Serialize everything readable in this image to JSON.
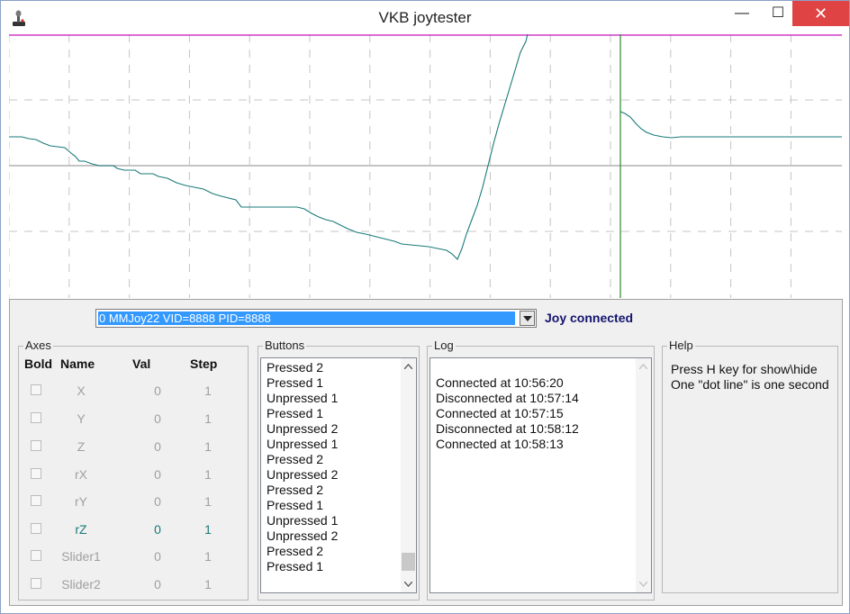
{
  "window": {
    "title": "VKB joytester",
    "minimize": "—",
    "maximize": "☐",
    "close": "✕"
  },
  "device": {
    "selected": "0 MMJoy22 VID=8888 PID=8888",
    "status": "Joy connected"
  },
  "axes": {
    "group_label": "Axes",
    "headers": {
      "bold": "Bold",
      "name": "Name",
      "val": "Val",
      "step": "Step"
    },
    "rows": [
      {
        "name": "X",
        "val": "0",
        "step": "1",
        "checked": false,
        "active": false
      },
      {
        "name": "Y",
        "val": "0",
        "step": "1",
        "checked": false,
        "active": false
      },
      {
        "name": "Z",
        "val": "0",
        "step": "1",
        "checked": false,
        "active": false
      },
      {
        "name": "rX",
        "val": "0",
        "step": "1",
        "checked": false,
        "active": false
      },
      {
        "name": "rY",
        "val": "0",
        "step": "1",
        "checked": false,
        "active": false
      },
      {
        "name": "rZ",
        "val": "0",
        "step": "1",
        "checked": false,
        "active": true
      },
      {
        "name": "Slider1",
        "val": "0",
        "step": "1",
        "checked": false,
        "active": false
      },
      {
        "name": "Slider2",
        "val": "0",
        "step": "1",
        "checked": false,
        "active": false
      }
    ]
  },
  "buttons": {
    "group_label": "Buttons",
    "items": [
      "Pressed 2",
      "Pressed 1",
      "Unpressed 1",
      "Pressed 1",
      "Unpressed 2",
      "Unpressed 1",
      "Pressed 2",
      "Unpressed 2",
      "Pressed 2",
      "Pressed 1",
      "Unpressed 1",
      "Unpressed 2",
      "Pressed 2",
      "Pressed 1"
    ]
  },
  "log": {
    "group_label": "Log",
    "items": [
      "",
      "Connected at 10:56:20",
      "Disconnected at 10:57:14",
      "Connected at 10:57:15",
      "Disconnected at 10:58:12",
      "Connected at 10:58:13"
    ]
  },
  "help": {
    "group_label": "Help",
    "lines": [
      "Press H key for show\\hide",
      "One \"dot line\" is one second"
    ]
  },
  "colors": {
    "trace": "#1a7a7a",
    "top_line": "#d23cc8",
    "marker": "#2a8a2a",
    "status": "#14146e",
    "selection": "#3399ff",
    "close": "#e04343"
  }
}
